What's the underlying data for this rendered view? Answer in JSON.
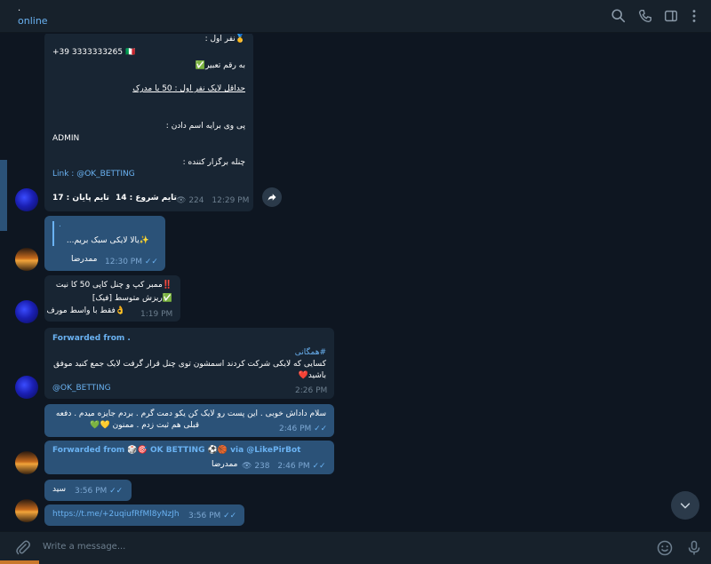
{
  "header": {
    "title_dot": ".",
    "status": "online",
    "icons": [
      "search-icon",
      "phone-icon",
      "sidebar-icon",
      "more-icon"
    ]
  },
  "messages": {
    "m1": {
      "line1": "🥇نفر اول :",
      "line2": "+39 3333333265 🇮🇹",
      "line3": "به رقم تعبیر✅",
      "line4": "حداقل لایک نفر اول : 50 با مدرک",
      "line5": "پی وی برایه اسم دادن :",
      "line6": "ADMIN",
      "line7": "چنله برگزار کننده :",
      "link_label": "Link : ",
      "link_value": "@OK_BETTING",
      "start_time": "تایم شروع : 14",
      "end_time": "تایم پایان : 17",
      "views": "224",
      "time": "12:29 PM"
    },
    "m2": {
      "quote_title": ".",
      "quote_text": "✨یالا لایکی سبک بریم...",
      "signature": "ممدرضا",
      "time": "12:30 PM"
    },
    "m3": {
      "line1": "‼️ممبر کپ و چنل کاپی 50 کا نیت",
      "line2": "✅ریزش متوسط [فیک]",
      "line3": "👌فقط با واسط مورف",
      "time": "1:19 PM"
    },
    "m4": {
      "forwarded": "Forwarded from .",
      "hashtag": "#همگانی",
      "body1": "کسایی که لایکی شرکت کردند اسمشون توی چنل قرار گرفت لایک جمع کنید موفق",
      "body2": "باشید❤️",
      "link": "@OK_BETTING",
      "time": "2:26 PM"
    },
    "m5": {
      "line1": "سلام داداش خوبی . این پست رو لایک کن یکو دمت گرم . بردم جایزه میدم . دفعه",
      "line2": "قبلی هم ثبت زدم . ممنون 💛💚",
      "time": "2:46 PM"
    },
    "m6": {
      "forwarded": "Forwarded from 🎲🎯 OK BETTING ⚽🏀 via @LikePirBot",
      "signature": "ممدرضا",
      "views": "238",
      "time": "2:46 PM"
    },
    "m7": {
      "text": "سید",
      "time": "3:56 PM"
    },
    "m8": {
      "link": "https://t.me/+2uqiufRfMl8yNzJh",
      "time": "3:56 PM"
    }
  },
  "composer": {
    "placeholder": "Write a message..."
  },
  "colors": {
    "background": "#0e1621",
    "header": "#17212b",
    "bubble_out": "#2b5278",
    "bubble_in": "#182533",
    "accent": "#6ab2f2"
  }
}
